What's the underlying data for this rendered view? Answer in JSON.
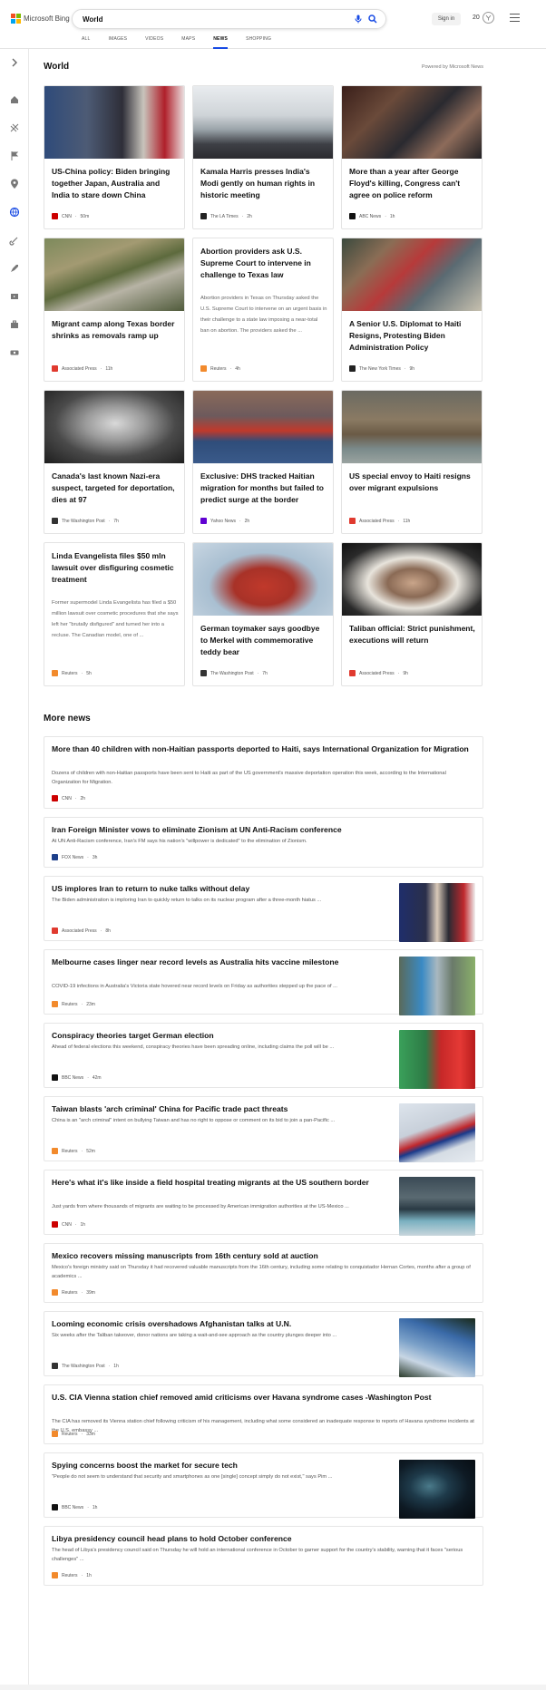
{
  "header": {
    "brand": "Microsoft Bing",
    "brand_colors": [
      "#f25022",
      "#7fba00",
      "#00a4ef",
      "#ffb900"
    ],
    "search_value": "World",
    "search_placeholder": "Search the web",
    "mic_icon": "mic-icon",
    "search_icon": "search-icon",
    "signin_label": "Sign in",
    "rewards_count": "20",
    "menu_icon": "hamburger-icon",
    "accent": "#174ae4"
  },
  "tabs": [
    {
      "label": "ALL"
    },
    {
      "label": "IMAGES"
    },
    {
      "label": "VIDEOS"
    },
    {
      "label": "MAPS"
    },
    {
      "label": "NEWS",
      "active": true
    },
    {
      "label": "SHOPPING"
    }
  ],
  "sidebar": {
    "icons": [
      "expand-icon",
      "home-icon",
      "sports-icon",
      "flag-icon",
      "location-icon",
      "world-icon",
      "science-icon",
      "rocket-icon",
      "entertainment-icon",
      "business-icon",
      "money-icon"
    ]
  },
  "section_title": "World",
  "powered_by": "Powered by Microsoft News",
  "cards": [
    {
      "title": "US-China policy: Biden bringing together Japan, Australia and India to stare down China",
      "source": "CNN",
      "time": "50m",
      "logo": "#cc0000",
      "img": "linear-gradient(90deg,#2f4b7a 0%,#4d5b75 30%,#2e2e38 55%,#c8c4bc 70%,#b01f2a 85%,#efefef 100%)"
    },
    {
      "title": "Kamala Harris presses India's Modi gently on human rights in historic meeting",
      "source": "The LA Times",
      "time": "2h",
      "logo": "#222222",
      "img": "linear-gradient(180deg,#e9ecef 0%,#cfd4d8 40%,#9aa3a9 60%,#3e4046 80%,#2b2b30 100%)"
    },
    {
      "title": "More than a year after George Floyd's killing, Congress can't agree on police reform",
      "source": "ABC News",
      "time": "1h",
      "logo": "#111111",
      "img": "linear-gradient(135deg,#3a1f1a 0%,#6a4a3a 30%,#2a2a30 55%,#8d6b5a 75%,#1e1e22 100%)"
    },
    {
      "title": "Migrant camp along Texas border shrinks as removals ramp up",
      "source": "Associated Press",
      "time": "11h",
      "logo": "#e03a2f",
      "img": "linear-gradient(160deg,#7d8a5c 0%,#a39a72 30%,#5d6a3d 50%,#b7b3a5 65%,#4f5a3a 100%)"
    },
    {
      "title": "Abortion providers ask U.S. Supreme Court to intervene in challenge to Texas law",
      "snippet": "Abortion providers in Texas on Thursday asked the U.S. Supreme Court to intervene on an urgent basis in their challenge to a state law imposing a near-total ban on abortion. The providers asked the ...",
      "source": "Reuters",
      "time": "4h",
      "logo": "#f28a2c"
    },
    {
      "title": "A Senior U.S. Diplomat to Haiti Resigns, Protesting Biden Administration Policy",
      "source": "The New York Times",
      "time": "9h",
      "logo": "#222222",
      "img": "linear-gradient(135deg,#3b4a3e 0%,#8a6d55 25%,#b73a3a 45%,#5a6a72 65%,#c9c2b0 100%)"
    },
    {
      "title": "Canada's last known Nazi-era suspect, targeted for deportation, dies at 97",
      "source": "The Washington Post",
      "time": "7h",
      "logo": "#333333",
      "img": "radial-gradient(ellipse at 50% 45%,#d9d9d9 0%,#9a9a9a 30%,#4a4a4a 60%,#1e1e1e 100%)"
    },
    {
      "title": "Exclusive: DHS tracked Haitian migration for months but failed to predict surge at the border",
      "source": "Yahoo News",
      "time": "2h",
      "logo": "#6001d2",
      "img": "linear-gradient(180deg,#8a6a5a 0%,#6d5a5c 35%,#c0392b 55%,#2f4d7a 70%,#3a5a8a 100%)"
    },
    {
      "title": "US special envoy to Haiti resigns over migrant expulsions",
      "source": "Associated Press",
      "time": "11h",
      "logo": "#e03a2f",
      "img": "linear-gradient(180deg,#6b6a62 0%,#8a7a63 40%,#6a5a45 60%,#7a8a8a 80%,#9aa3a0 100%)"
    },
    {
      "title": "Linda Evangelista files $50 mln lawsuit over disfiguring cosmetic treatment",
      "snippet": "Former supermodel Linda Evangelista has filed a $50 million lawsuit over cosmetic procedures that she says left her \"brutally disfigured\" and turned her into a recluse. The Canadian model, one of ...",
      "source": "Reuters",
      "time": "5h",
      "logo": "#f28a2c"
    },
    {
      "title": "German toymaker says goodbye to Merkel with commemorative teddy bear",
      "source": "The Washington Post",
      "time": "7h",
      "logo": "#333333",
      "img": "radial-gradient(ellipse at 50% 60%,#c0392b 0%,#a83228 30%,#a9bfd1 55%,#c8d6e2 100%)"
    },
    {
      "title": "Taliban official: Strict punishment, executions will return",
      "source": "Associated Press",
      "time": "9h",
      "logo": "#e03a2f",
      "img": "radial-gradient(ellipse at 50% 55%,#c9a58a 0%,#8a6a55 25%,#e8e4dc 45%,#2a2a2a 75%,#111 100%)"
    }
  ],
  "more_news_title": "More news",
  "more_news": [
    {
      "title": "More than 40 children with non-Haitian passports deported to Haiti, says International Organization for Migration",
      "snippet": "Dozens of children with non-Haitian passports have been sent to Haiti as part of the US government's massive deportation operation this week, according to the International Organization for Migration.",
      "source": "CNN",
      "time": "2h",
      "logo": "#cc0000"
    },
    {
      "title": "Iran Foreign Minister vows to eliminate Zionism at UN Anti-Racism conference",
      "snippet": "At UN Anti-Racism conference, Iran's FM says his nation's \"willpower is dedicated\" to the elimination of Zionism.",
      "source": "FOX News",
      "time": "3h",
      "logo": "#1d3f8a"
    },
    {
      "title": "US implores Iran to return to nuke talks without delay",
      "snippet": "The Biden administration is imploring Iran to quickly return to talks on its nuclear program after a three-month hiatus ...",
      "source": "Associated Press",
      "time": "8h",
      "logo": "#e03a2f",
      "img": "linear-gradient(90deg,#1f2e6b 0%,#2a2f4a 35%,#d9c9b8 50%,#2a2a33 65%,#c0282d 85%,#f0f0f0 100%)"
    },
    {
      "title": "Melbourne cases linger near record levels as Australia hits vaccine milestone",
      "snippet": "COVID-19 infections in Australia's Victoria state hovered near record levels on Friday as authorities stepped up the pace of ...",
      "source": "Reuters",
      "time": "23m",
      "logo": "#f28a2c",
      "img": "linear-gradient(90deg,#5a6a5a 0%,#3a8ac4 30%,#a9b8c0 50%,#6a7a6a 70%,#8ab06a 100%)"
    },
    {
      "title": "Conspiracy theories target German election",
      "snippet": "Ahead of federal elections this weekend, conspiracy theories have been spreading online, including claims the poll will be ...",
      "source": "BBC News",
      "time": "42m",
      "logo": "#111111",
      "img": "linear-gradient(90deg,#3aa05a 0%,#2d7a45 35%,#c62828 55%,#e53935 80%,#b71c1c 100%)"
    },
    {
      "title": "Taiwan blasts 'arch criminal' China for Pacific trade pact threats",
      "snippet": "China is an \"arch criminal\" intent on bullying Taiwan and has no right to oppose or comment on its bid to join a pan-Pacific ...",
      "source": "Reuters",
      "time": "52m",
      "logo": "#f28a2c",
      "img": "linear-gradient(160deg,#dde4ec 0%,#c8d0da 40%,#c0282d 55%,#1a3a8a 62%,#d5dce4 75%,#e6ebf0 100%)"
    },
    {
      "title": "Here's what it's like inside a field hospital treating migrants at the US southern border",
      "snippet": "Just yards from where thousands of migrants are waiting to be processed by American immigration authorities at the US-Mexico ...",
      "source": "CNN",
      "time": "1h",
      "logo": "#cc0000",
      "img": "linear-gradient(180deg,#3a4a55 0%,#5a6a72 35%,#2a3a44 55%,#7ab0c0 75%,#c8d6dc 100%)"
    },
    {
      "title": "Mexico recovers missing manuscripts from 16th century sold at auction",
      "snippet": "Mexico's foreign ministry said on Thursday it had recovered valuable manuscripts from the 16th century, including some relating to conquistador Hernan Cortes, months after a group of academics ...",
      "source": "Reuters",
      "time": "39m",
      "logo": "#f28a2c"
    },
    {
      "title": "Looming economic crisis overshadows Afghanistan talks at U.N.",
      "snippet": "Six weeks after the Taliban takeover, donor nations are taking a wait-and-see approach as the country plunges deeper into ...",
      "source": "The Washington Post",
      "time": "1h",
      "logo": "#333333",
      "img": "linear-gradient(200deg,#1a2a1a 0%,#3a6aa8 30%,#7aa0c8 55%,#c8d6e4 75%,#2a3a2a 100%)"
    },
    {
      "title": "U.S. CIA Vienna station chief removed amid criticisms over Havana syndrome cases -Washington Post",
      "snippet": "The CIA has removed its Vienna station chief following criticism of his management, including what some considered an inadequate response to reports of Havana syndrome incidents at the U.S. embassy ...",
      "source": "Reuters",
      "time": "33m",
      "logo": "#f28a2c"
    },
    {
      "title": "Spying concerns boost the market for secure tech",
      "snippet": "\"People do not seem to understand that security and smartphones as one [single] concept simply do not exist,\" says Pim ...",
      "source": "BBC News",
      "time": "1h",
      "logo": "#111111",
      "img": "radial-gradient(ellipse at 40% 45%,#4a7a8a 0%,#1e3a4a 30%,#0e1a24 60%,#05090d 100%)"
    },
    {
      "title": "Libya presidency council head plans to hold October conference",
      "snippet": "The head of Libya's presidency council said on Thursday he will hold an international conference in October to garner support for the country's stability, warning that it faces \"serious challenges\" ...",
      "source": "Reuters",
      "time": "1h",
      "logo": "#f28a2c"
    }
  ]
}
